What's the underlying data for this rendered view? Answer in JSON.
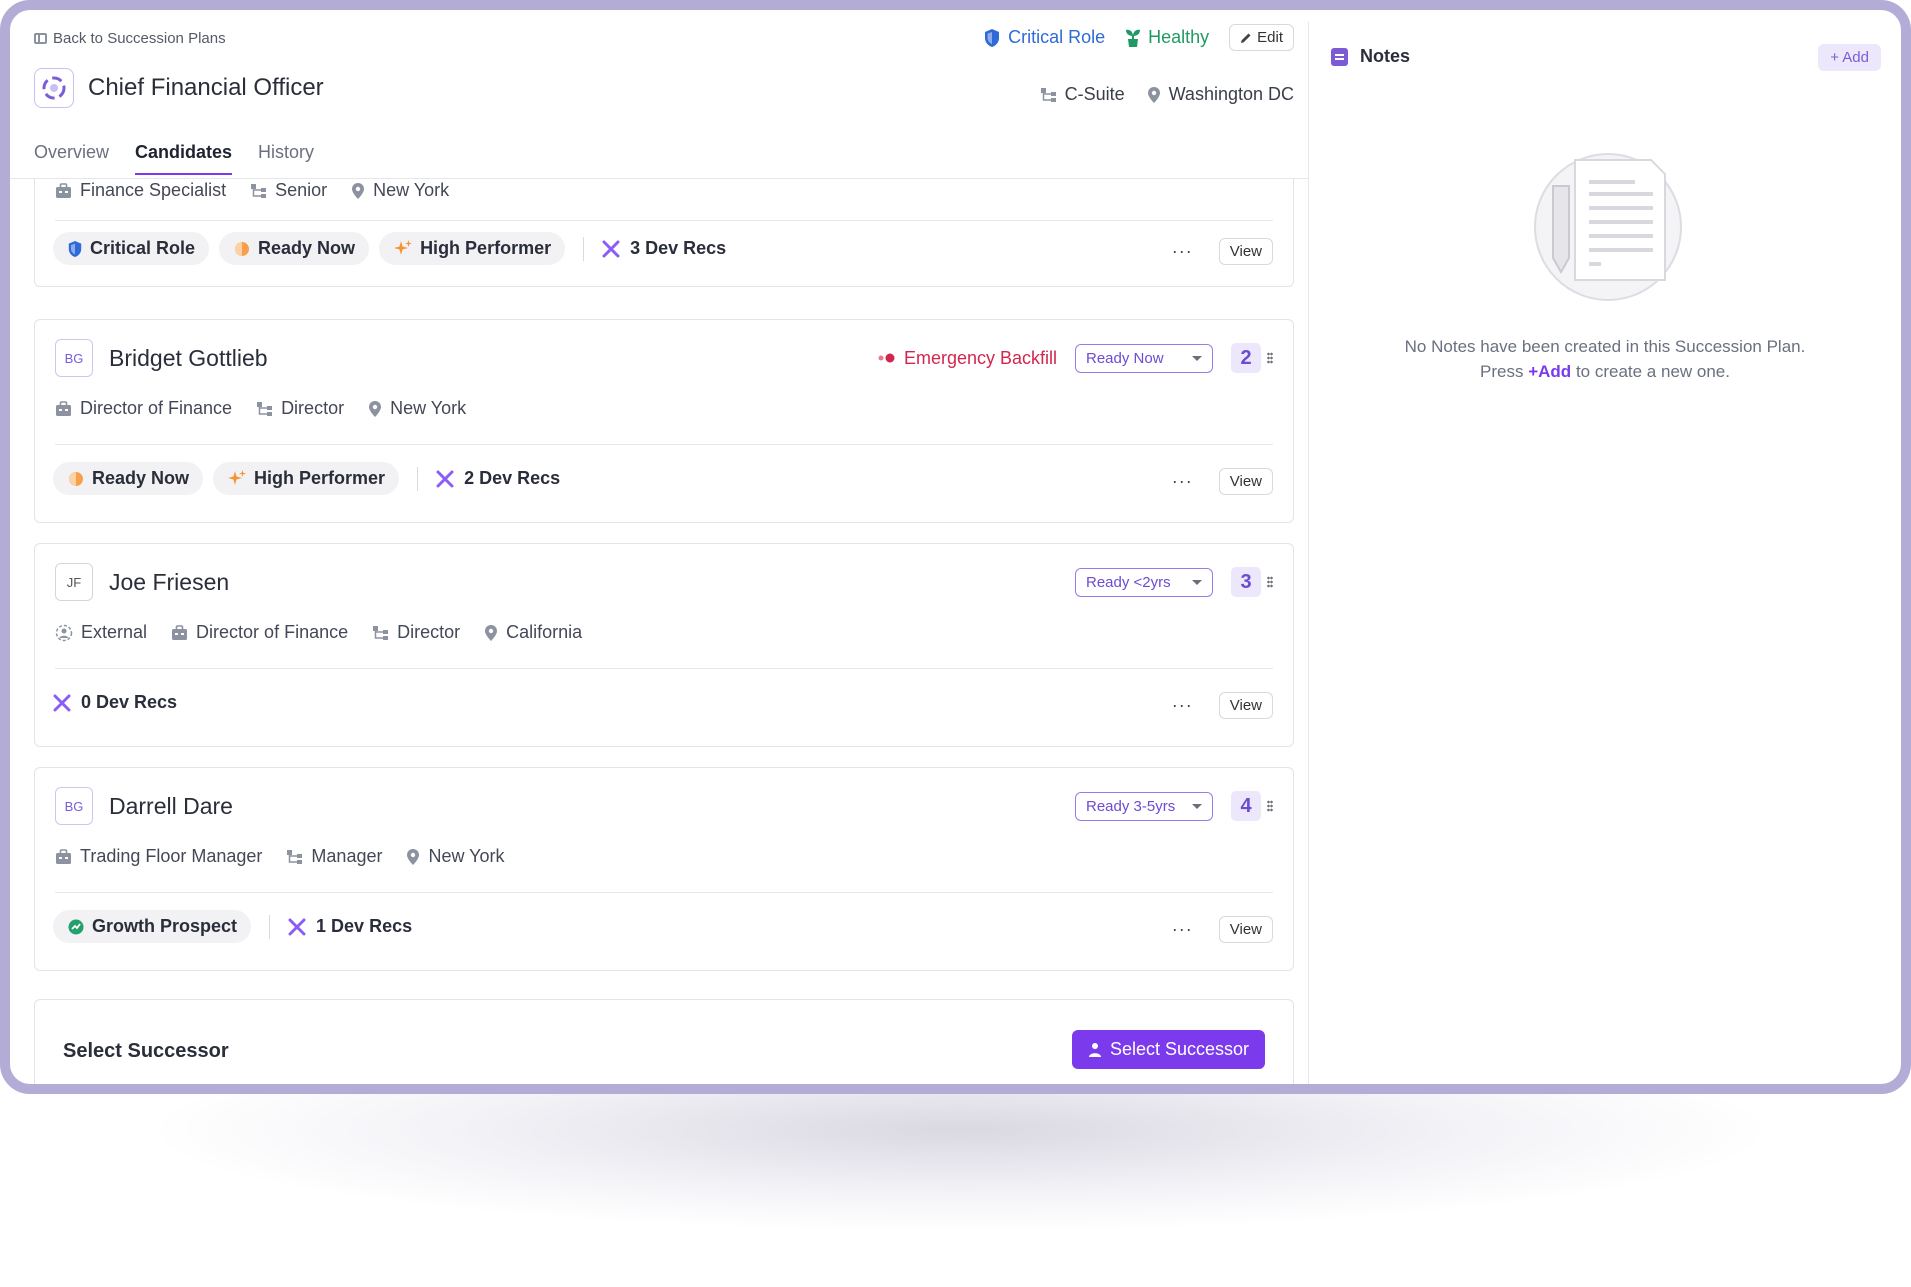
{
  "header": {
    "back_label": "Back to Succession Plans",
    "critical_label": "Critical Role",
    "healthy_label": "Healthy",
    "edit_label": "Edit",
    "title": "Chief Financial Officer",
    "level": "C-Suite",
    "location": "Washington DC"
  },
  "tabs": [
    {
      "label": "Overview"
    },
    {
      "label": "Candidates"
    },
    {
      "label": "History"
    }
  ],
  "candidate0": {
    "meta": [
      "Finance Specialist",
      "Senior",
      "New York"
    ],
    "tags": [
      "Critical Role",
      "Ready Now",
      "High Performer"
    ],
    "devrecs": "3 Dev Recs"
  },
  "candidate1": {
    "initials": "BG",
    "name": "Bridget Gottlieb",
    "flag": "Emergency Backfill",
    "readiness": "Ready Now",
    "rank": "2",
    "meta": [
      "Director of Finance",
      "Director",
      "New York"
    ],
    "tags": [
      "Ready Now",
      "High Performer"
    ],
    "devrecs": "2 Dev Recs"
  },
  "candidate2": {
    "initials": "JF",
    "name": "Joe Friesen",
    "readiness": "Ready <2yrs",
    "rank": "3",
    "meta": [
      "External",
      "Director of Finance",
      "Director",
      "California"
    ],
    "devrecs": "0 Dev Recs"
  },
  "candidate3": {
    "initials": "BG",
    "name": "Darrell Dare",
    "readiness": "Ready 3-5yrs",
    "rank": "4",
    "meta": [
      "Trading Floor Manager",
      "Manager",
      "New York"
    ],
    "tags": [
      "Growth Prospect"
    ],
    "devrecs": "1 Dev Recs"
  },
  "common": {
    "more": "···",
    "view": "View"
  },
  "select": {
    "title": "Select Successor",
    "button": "Select Successor"
  },
  "notes": {
    "title": "Notes",
    "add": "+ Add",
    "empty_line1": "No Notes have been created in this Succession Plan.",
    "empty_press": "Press",
    "empty_link": "+Add",
    "empty_tail": "to create a new one."
  },
  "colors": {
    "accent": "#7c3aed",
    "critical": "#2e6ad8",
    "healthy": "#1f9a62",
    "emergency": "#d1264e"
  }
}
